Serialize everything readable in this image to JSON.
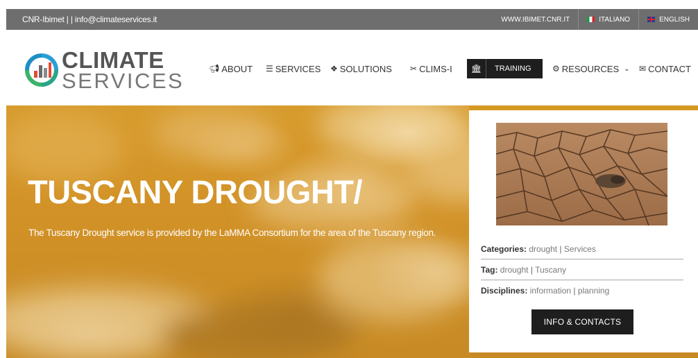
{
  "topbar": {
    "contact_text": "CNR-Ibimet |  | info@climateservices.it",
    "site_link": "WWW.IBIMET.CNR.IT",
    "lang_it": "ITALIANO",
    "lang_en": "ENGLISH"
  },
  "logo": {
    "line1": "CLIMATE",
    "line2": "SERVICES"
  },
  "nav": {
    "about": "ABOUT",
    "services": "SERVICES",
    "solutions": "SOLUTIONS",
    "clims": "CLIMS-I",
    "training": "TRAINING",
    "resources": "RESOURCES",
    "contact": "CONTACT"
  },
  "hero": {
    "title": "TUSCANY DROUGHT/",
    "subtitle": "The Tuscany Drought service is provided by the LaMMA Consortium for the area of the Tuscany region."
  },
  "card": {
    "categories_label": "Categories:",
    "categories": [
      "drought",
      "Services"
    ],
    "tag_label": "Tag:",
    "tags": [
      "drought",
      "Tuscany"
    ],
    "disciplines_label": "Disciplines:",
    "disciplines": [
      "information",
      "planning"
    ],
    "cta": "INFO & CONTACTS",
    "separator": "|"
  },
  "colors": {
    "topbar_bg": "#6e6e6e",
    "hero_accent": "#d49a23",
    "dark_button": "#1e1e1e"
  }
}
